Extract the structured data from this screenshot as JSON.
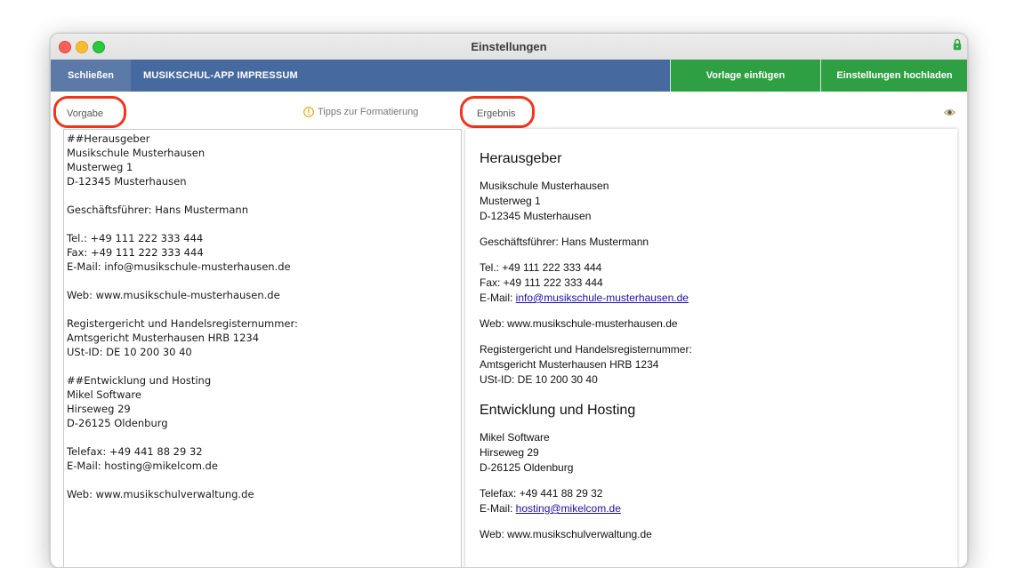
{
  "window": {
    "title": "Einstellungen"
  },
  "toolbar": {
    "close_label": "Schließen",
    "title": "MUSIKSCHUL-APP IMPRESSUM",
    "insert_label": "Vorlage einfügen",
    "upload_label": "Einstellungen hochladen"
  },
  "left": {
    "label": "Vorgabe",
    "tips_label": "Tipps zur Formatierung",
    "source": "##Herausgeber\nMusikschule Musterhausen\nMusterweg 1\nD-12345 Musterhausen\n\nGeschäftsführer: Hans Mustermann\n\nTel.: +49 111 222 333 444\nFax: +49 111 222 333 444\nE-Mail: info@musikschule-musterhausen.de\n\nWeb: www.musikschule-musterhausen.de\n\nRegistergericht und Handelsregisternummer:\nAmtsgericht Musterhausen HRB 1234\nUSt-ID: DE 10 200 30 40\n\n##Entwicklung und Hosting\nMikel Software\nHirseweg 29\nD-26125 Oldenburg\n\nTelefax: +49 441 88 29 32\nE-Mail: hosting@mikelcom.de\n\nWeb: www.musikschulverwaltung.de"
  },
  "right": {
    "label": "Ergebnis",
    "section1": {
      "heading": "Herausgeber",
      "name": "Musikschule Musterhausen",
      "street": "Musterweg 1",
      "city": "D-12345 Musterhausen",
      "ceo": "Geschäftsführer: Hans Mustermann",
      "tel": "Tel.: +49 111 222 333 444",
      "fax": "Fax: +49 111 222 333 444",
      "email_prefix": "E-Mail: ",
      "email_link": "info@musikschule-musterhausen.de",
      "web": "Web: www.musikschule-musterhausen.de",
      "reg1": "Registergericht und Handelsregisternummer:",
      "reg2": "Amtsgericht Musterhausen HRB 1234",
      "reg3": "USt-ID: DE 10 200 30 40"
    },
    "section2": {
      "heading": "Entwicklung und Hosting",
      "name": "Mikel Software",
      "street": "Hirseweg 29",
      "city": "D-26125 Oldenburg",
      "fax": "Telefax: +49 441 88 29 32",
      "email_prefix": "E-Mail: ",
      "email_link": "hosting@mikelcom.de",
      "web": "Web: www.musikschulverwaltung.de"
    }
  },
  "colors": {
    "toolbar": "#466a9f",
    "close_button": "#5b7aa8",
    "green_button": "#2ea043",
    "highlight_ring": "#f0351c"
  }
}
